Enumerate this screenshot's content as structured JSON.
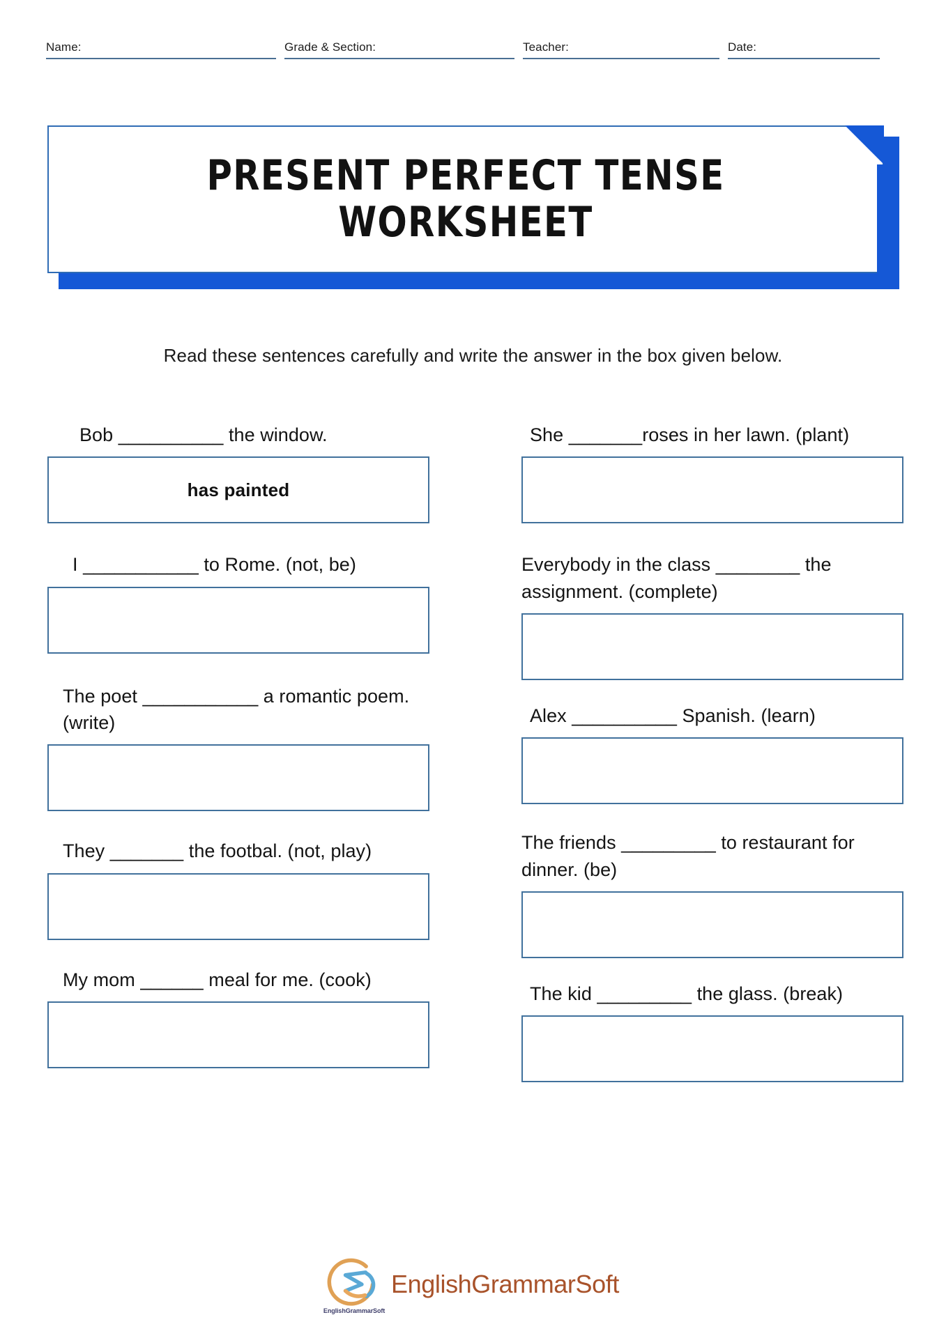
{
  "header": {
    "fields": [
      {
        "label": "Name:"
      },
      {
        "label": "Grade & Section:"
      },
      {
        "label": "Teacher:"
      },
      {
        "label": "Date:"
      }
    ]
  },
  "banner": {
    "title": "PRESENT PERFECT TENSE WORKSHEET",
    "accent_color": "#1558d6",
    "border_color": "#2f6cb5"
  },
  "instructions": {
    "text": "Read these sentences carefully and write the answer in the box given below."
  },
  "worksheet": {
    "box_border_color": "#41719c",
    "left_column": [
      {
        "question": "Bob __________ the window.",
        "answer": "has painted"
      },
      {
        "question": "I ___________ to Rome. (not, be)",
        "answer": ""
      },
      {
        "question": "The poet ___________ a romantic poem. (write)",
        "answer": ""
      },
      {
        "question": "They _______ the footbal. (not, play)",
        "answer": ""
      },
      {
        "question": "My mom ______ meal for me. (cook)",
        "answer": ""
      }
    ],
    "right_column": [
      {
        "question": "She _______roses in her lawn. (plant)",
        "answer": ""
      },
      {
        "question": "Everybody in the class ________ the assignment. (complete)",
        "answer": ""
      },
      {
        "question": "Alex __________ Spanish. (learn)",
        "answer": ""
      },
      {
        "question": "The friends _________ to restaurant for dinner. (be)",
        "answer": ""
      },
      {
        "question": "The kid _________ the glass. (break)",
        "answer": ""
      }
    ]
  },
  "footer": {
    "brand": "EnglishGrammarSoft",
    "logo_caption": "EnglishGrammarSoft",
    "logo_ring_color": "#e0a155",
    "logo_ribbon_color": "#5aa9d6",
    "brand_color": "#a8522a"
  }
}
